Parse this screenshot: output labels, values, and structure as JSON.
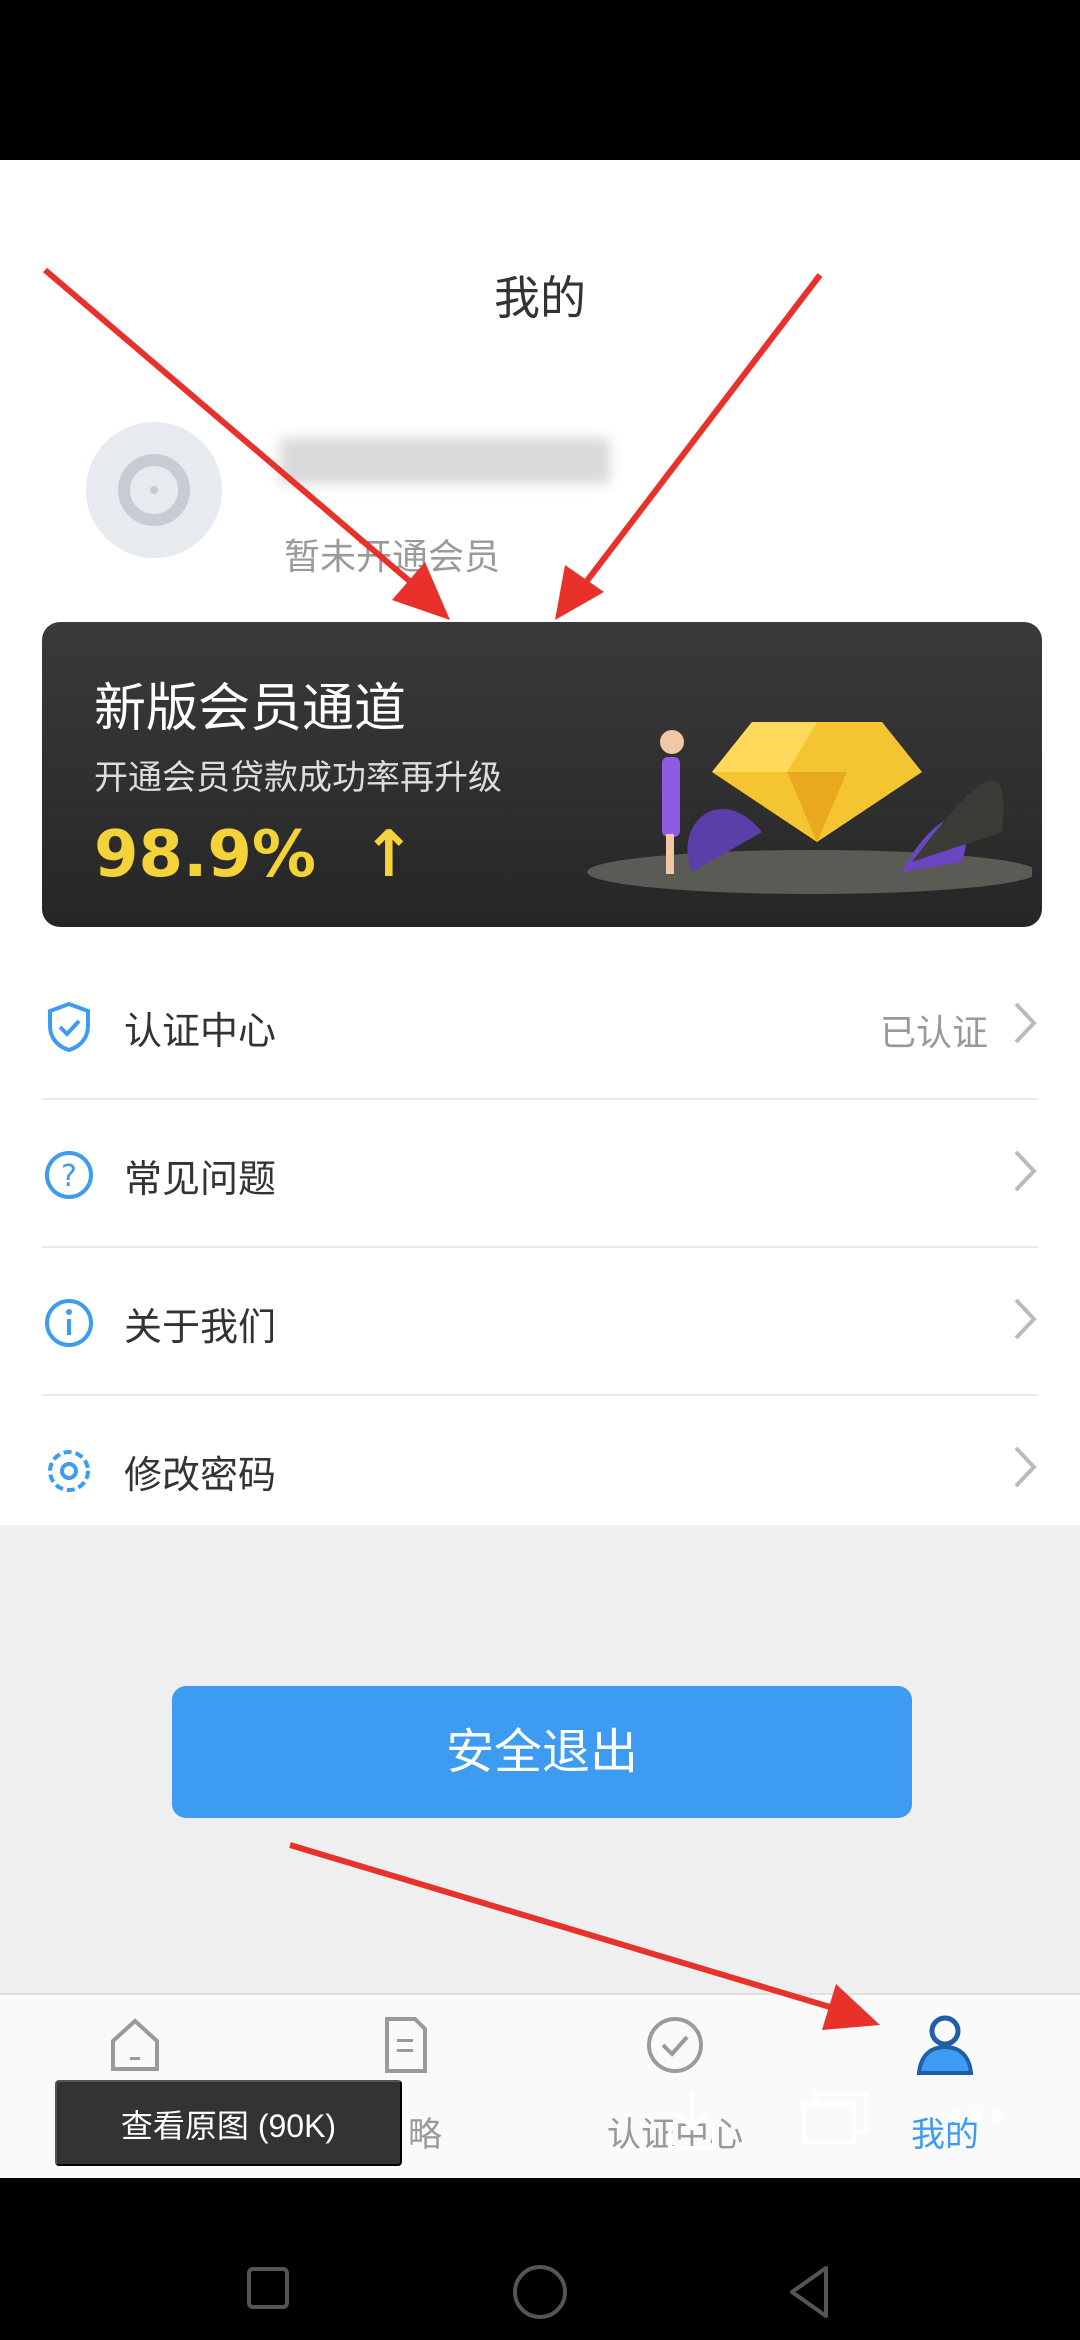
{
  "page": {
    "title": "我的"
  },
  "profile": {
    "member_status": "暂未开通会员"
  },
  "banner": {
    "title": "新版会员通道",
    "subtitle": "开通会员贷款成功率再升级",
    "rate": "98.9%",
    "arrow": "↑"
  },
  "menu": [
    {
      "label": "认证中心",
      "value": "已认证",
      "icon": "shield-check-icon"
    },
    {
      "label": "常见问题",
      "value": "",
      "icon": "question-circle-icon"
    },
    {
      "label": "关于我们",
      "value": "",
      "icon": "info-circle-icon"
    },
    {
      "label": "修改密码",
      "value": "",
      "icon": "gear-icon"
    }
  ],
  "logout": {
    "label": "安全退出"
  },
  "tabbar": {
    "items": [
      {
        "label": "",
        "icon": "home-icon",
        "active": false
      },
      {
        "label": "略",
        "icon": "document-icon",
        "active": false
      },
      {
        "label": "认证中心",
        "icon": "check-circle-icon",
        "active": false
      },
      {
        "label": "我的",
        "icon": "user-icon",
        "active": true
      }
    ]
  },
  "viewer": {
    "view_original": "查看原图 (90K)"
  },
  "colors": {
    "accent": "#3e9bf2",
    "highlight": "#f4d23a",
    "annotation_arrow": "#e8312a"
  }
}
